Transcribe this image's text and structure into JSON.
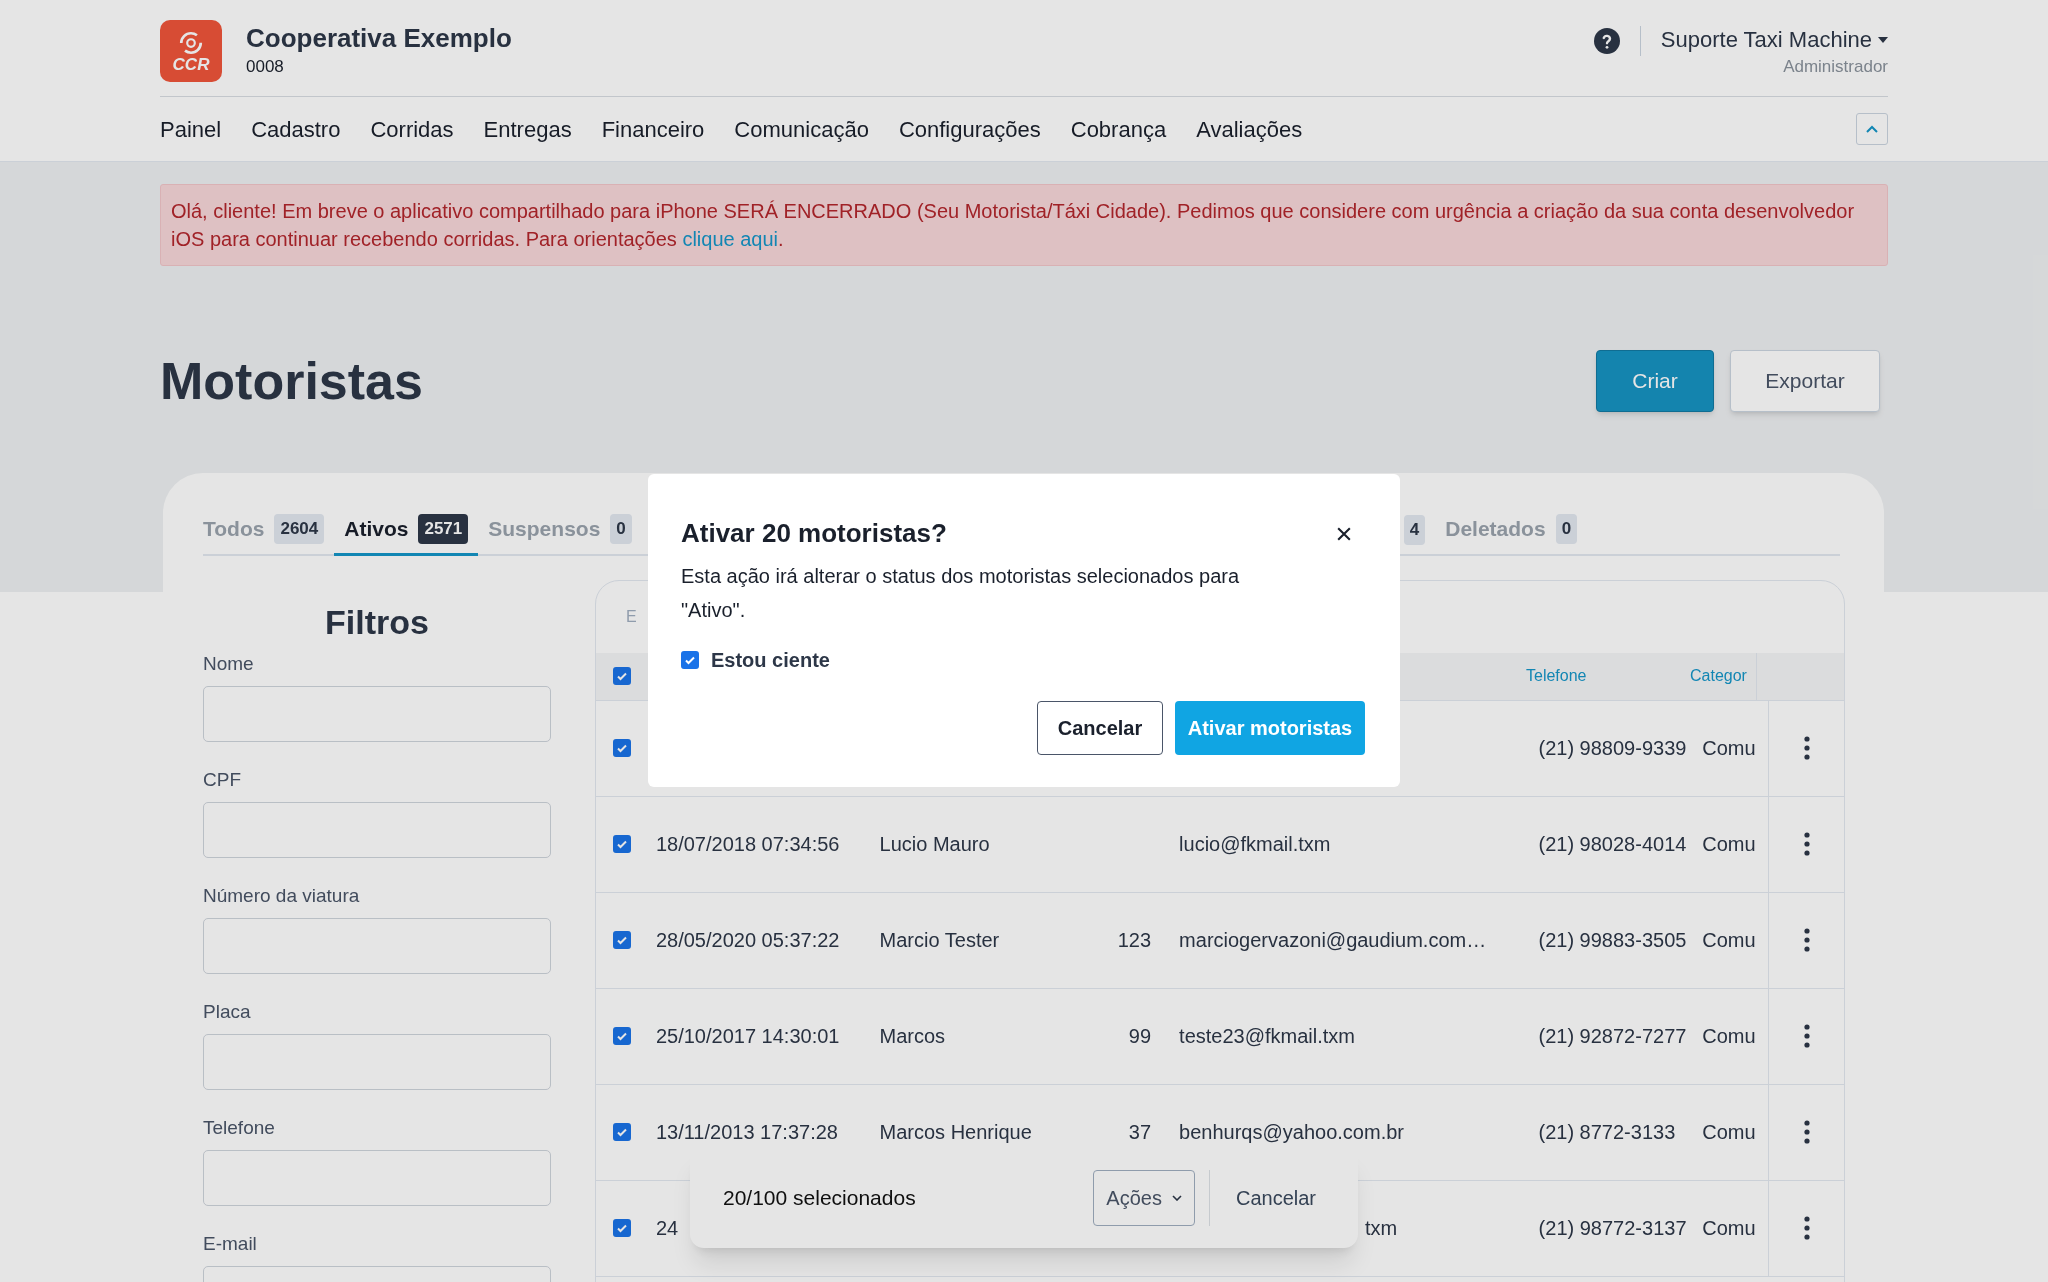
{
  "header": {
    "logo_text": "CCR",
    "title": "Cooperativa Exemplo",
    "code": "0008",
    "user": "Suporte Taxi Machine",
    "role": "Administrador"
  },
  "nav": [
    {
      "label": "Painel"
    },
    {
      "label": "Cadastro"
    },
    {
      "label": "Corridas"
    },
    {
      "label": "Entregas"
    },
    {
      "label": "Financeiro"
    },
    {
      "label": "Comunicação"
    },
    {
      "label": "Configurações"
    },
    {
      "label": "Cobrança"
    },
    {
      "label": "Avaliações"
    }
  ],
  "alert": {
    "text": "Olá, cliente! Em breve o aplicativo compartilhado para iPhone SERÁ ENCERRADO (Seu Motorista/Táxi Cidade). Pedimos que considere com urgência a criação da sua conta desenvolvedor iOS para continuar recebendo corridas. Para orientações",
    "link": "clique aqui",
    "end": "."
  },
  "page_title": "Motoristas",
  "actions": [
    "Criar",
    "Exportar"
  ],
  "tabs": [
    {
      "label": "Todos",
      "count": "2604",
      "selected": false
    },
    {
      "label": "Ativos",
      "count": "2571",
      "selected": true
    },
    {
      "label": "Suspensos",
      "count": "0",
      "selected": false
    },
    {
      "count": "4",
      "selected": false
    },
    {
      "label": "Deletados",
      "count": "0",
      "selected": false
    }
  ],
  "filters": {
    "title": "Filtros",
    "fields": [
      "Nome",
      "CPF",
      "Número da viatura",
      "Placa",
      "Telefone",
      "E-mail"
    ]
  },
  "table": {
    "toolbar_text": "E",
    "header_checked": true,
    "columns": {
      "phone": "Telefone",
      "category": "Categor"
    },
    "rows": [
      {
        "checked": true,
        "phone": "(21) 98809-9339",
        "category": "Comu"
      },
      {
        "checked": true,
        "date": "18/07/2018 07:34:56",
        "name": "Lucio Mauro",
        "email": "lucio@fkmail.txm",
        "phone": "(21) 98028-4014",
        "category": "Comu"
      },
      {
        "checked": true,
        "date": "28/05/2020 05:37:22",
        "name": "Marcio Tester",
        "number": "123",
        "email": "marciogervazoni@gaudium.com…",
        "phone": "(21) 99883-3505",
        "category": "Comu"
      },
      {
        "checked": true,
        "date": "25/10/2017 14:30:01",
        "name": "Marcos",
        "number": "99",
        "email": "teste23@fkmail.txm",
        "phone": "(21) 92872-7277",
        "category": "Comu"
      },
      {
        "checked": true,
        "date": "13/11/2013 17:37:28",
        "name": "Marcos Henrique",
        "number": "37",
        "email": "benhurqs@yahoo.com.br",
        "phone": "(21) 8772-3133",
        "category": "Comu"
      },
      {
        "checked": true,
        "covered": true,
        "date": "24",
        "email": "txm",
        "phone": "(21) 98772-3137",
        "category": "Comu"
      }
    ]
  },
  "selection_bar": {
    "text": "20/100 selecionados",
    "actions": "Ações",
    "cancel": "Cancelar"
  },
  "modal": {
    "title": "Ativar 20 motoristas?",
    "body": "Esta ação irá alterar o status dos motoristas selecionados para \"Ativo\".",
    "confirm_label": "Estou ciente",
    "confirm_checked": true,
    "cancel": "Cancelar",
    "submit": "Ativar motoristas"
  }
}
